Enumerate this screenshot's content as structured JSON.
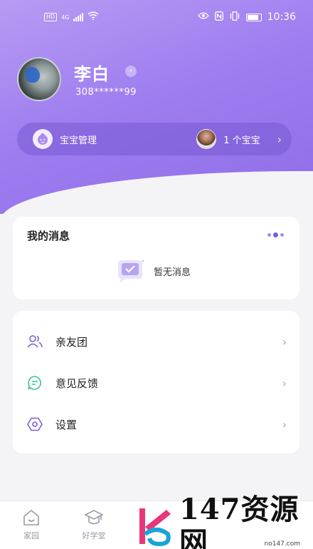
{
  "status_bar": {
    "left_badges": [
      "HD",
      "4G"
    ],
    "time": "10:36"
  },
  "profile": {
    "name": "李白",
    "id_masked": "308******99",
    "name_arrow": "›"
  },
  "baby_bar": {
    "label": "宝宝管理",
    "count_label": "1 个宝宝",
    "chevron": "›"
  },
  "messages": {
    "title": "我的消息",
    "empty_text": "暂无消息"
  },
  "menu": {
    "items": [
      {
        "label": "亲友团",
        "icon": "family-group-icon"
      },
      {
        "label": "意见反馈",
        "icon": "feedback-chat-icon"
      },
      {
        "label": "设置",
        "icon": "settings-hexagon-icon"
      }
    ],
    "chevron": "›"
  },
  "bottom_nav": {
    "items": [
      {
        "label": "家园",
        "icon": "home-icon"
      },
      {
        "label": "好学堂",
        "icon": "graduation-cap-icon"
      }
    ]
  },
  "watermark": {
    "text": "147资源网",
    "url": "no147.com"
  },
  "colors": {
    "accent_purple": "#8e6ce8",
    "icon_purple": "#7a5fd6",
    "icon_green": "#3cc49a",
    "background": "#f4f4f7"
  }
}
